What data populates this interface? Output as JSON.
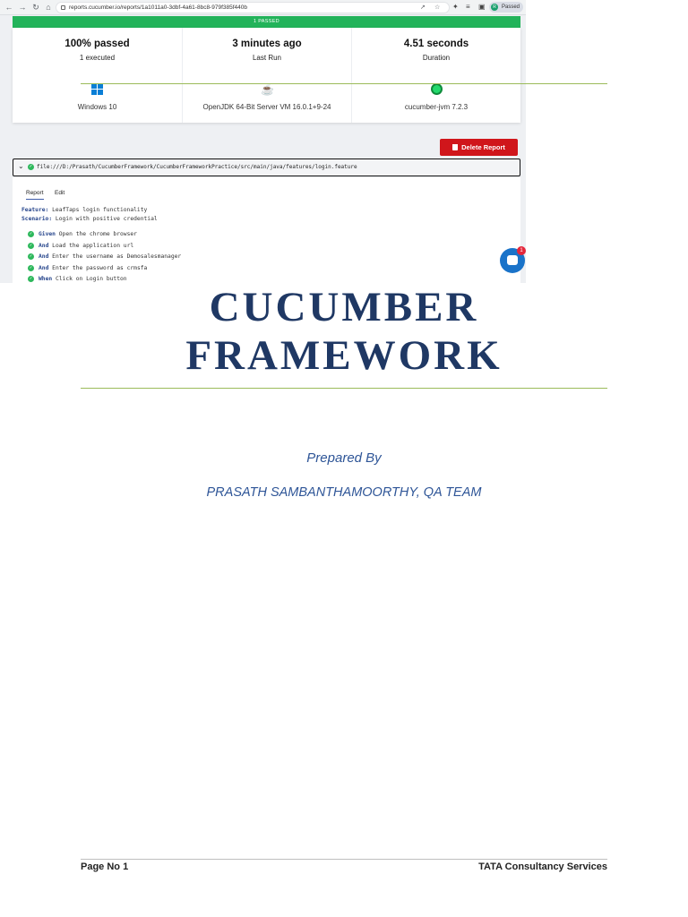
{
  "browser": {
    "url": "reports.cucumber.io/reports/1a1011a0-3dbf-4a61-8bc8-979f385f440b",
    "profile_label": "Passed",
    "profile_initial": "R"
  },
  "report": {
    "banner": "1 PASSED",
    "stats": [
      {
        "value": "100% passed",
        "sub": "1 executed"
      },
      {
        "value": "3 minutes ago",
        "sub": "Last Run"
      },
      {
        "value": "4.51 seconds",
        "sub": "Duration"
      }
    ],
    "environment": [
      {
        "icon": "windows-icon",
        "label": "Windows 10"
      },
      {
        "icon": "java-icon",
        "label": "OpenJDK 64-Bit Server VM 16.0.1+9-24"
      },
      {
        "icon": "cucumber-icon",
        "label": "cucumber-jvm 7.2.3"
      }
    ],
    "delete_label": "Delete Report",
    "feature_path": "file:///D:/Prasath/CucumberFramework/CucumberFrameworkPractice/src/main/java/features/login.feature",
    "tabs": [
      "Report",
      "Edit"
    ],
    "feature": {
      "keyword": "Feature:",
      "text": " LeafTaps login functionality"
    },
    "scenario": {
      "keyword": "Scenario:",
      "text": " Login with positive credential"
    },
    "steps": [
      {
        "keyword": "Given",
        "text": " Open the chrome browser"
      },
      {
        "keyword": "And",
        "text": " Load the application url"
      },
      {
        "keyword": "And",
        "text": " Enter the username as Demosalesmanager"
      },
      {
        "keyword": "And",
        "text": " Enter the password as crmsfa"
      },
      {
        "keyword": "When",
        "text": " Click on Login button"
      }
    ],
    "chat_badge": "1",
    "colors": {
      "pass": "#22b35a",
      "delete": "#d0161b",
      "keyword": "#26458c"
    }
  },
  "document": {
    "title_line1": "CUCUMBER",
    "title_line2": "FRAMEWORK",
    "prepared_by": "Prepared By",
    "author": "PRASATH SAMBANTHAMOORTHY, QA TEAM",
    "footer_left": "Page No 1",
    "footer_right": "TATA Consultancy Services",
    "colors": {
      "title": "#1f3864",
      "accent_rule": "#9bbb59",
      "subtitle": "#2e5597"
    }
  }
}
